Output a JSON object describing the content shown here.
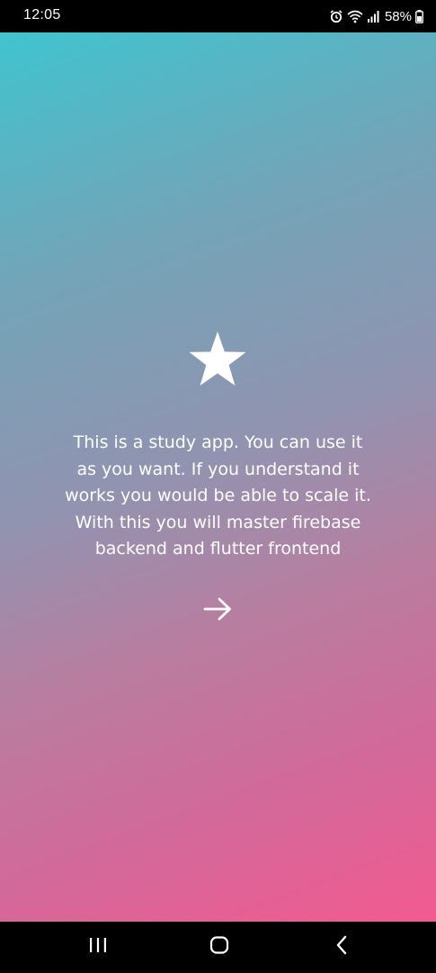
{
  "status_bar": {
    "time": "12:05",
    "battery_percent": "58%",
    "icons": [
      "alarm-icon",
      "wifi-icon",
      "signal-icon",
      "battery-icon"
    ]
  },
  "main": {
    "icon": "star-icon",
    "description": "This is a study app. You can use it\nas you want. If you understand it\nworks you would be able to scale it.\nWith this you will master firebase\nbackend and flutter frontend",
    "next_icon": "arrow-right-icon",
    "gradient": {
      "start": "#40c4cf",
      "end": "#f25a90"
    }
  },
  "nav_bar": {
    "icons": [
      "recent-apps-icon",
      "home-icon",
      "back-icon"
    ]
  }
}
